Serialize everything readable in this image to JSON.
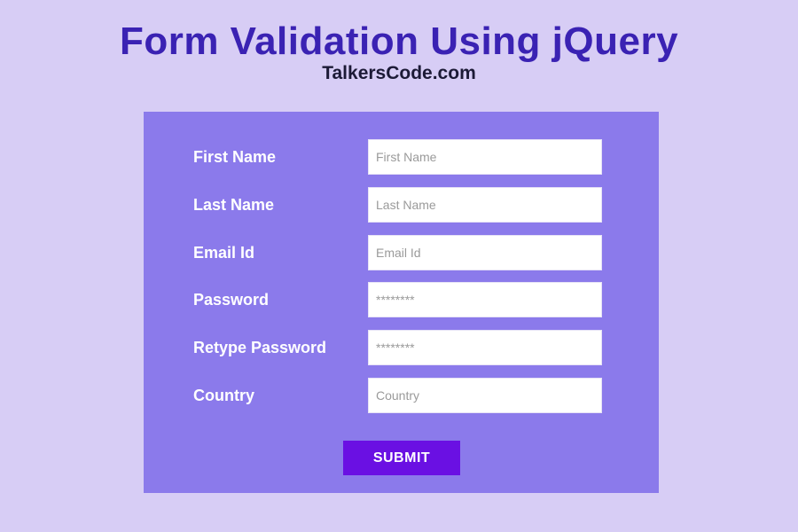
{
  "header": {
    "title": "Form Validation Using jQuery",
    "subtitle": "TalkersCode.com"
  },
  "form": {
    "fields": [
      {
        "label": "First Name",
        "placeholder": "First Name",
        "type": "text"
      },
      {
        "label": "Last Name",
        "placeholder": "Last Name",
        "type": "text"
      },
      {
        "label": "Email Id",
        "placeholder": "Email Id",
        "type": "text"
      },
      {
        "label": "Password",
        "placeholder": "********",
        "type": "password"
      },
      {
        "label": "Retype Password",
        "placeholder": "********",
        "type": "password"
      },
      {
        "label": "Country",
        "placeholder": "Country",
        "type": "text"
      }
    ],
    "submit_label": "SUBMIT"
  },
  "colors": {
    "background": "#d7cdf5",
    "panel": "#8b7aeb",
    "title": "#3a22b3",
    "button": "#6a10e3"
  }
}
